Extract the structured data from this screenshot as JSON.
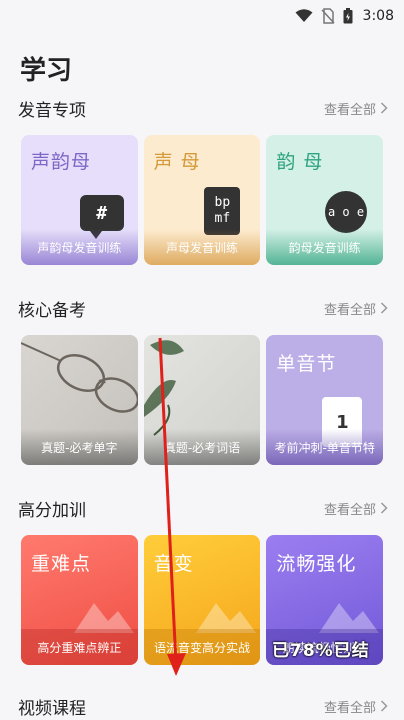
{
  "status": {
    "time": "3:08"
  },
  "page_title": "学习",
  "pronunciation": {
    "title": "发音专项",
    "more": "查看全部",
    "cards": [
      {
        "big": "声韵母",
        "badge": "#",
        "label": "声韵母发音训练"
      },
      {
        "big": "声母",
        "badge": "bp\nmf",
        "label": "声母发音训练"
      },
      {
        "big": "韵母",
        "badge": "a o e",
        "label": "韵母发音训练"
      }
    ]
  },
  "exam": {
    "title": "核心备考",
    "more": "查看全部",
    "cards": [
      {
        "label": "真题-必考单字"
      },
      {
        "label": "真题-必考词语"
      },
      {
        "big": "单音节",
        "flip": "1",
        "label": "考前冲刺-单音节特"
      }
    ]
  },
  "training": {
    "title": "高分加训",
    "more": "查看全部",
    "cards": [
      {
        "big": "重难点",
        "label": "高分重难点辨正"
      },
      {
        "big": "音变",
        "label": "语流音变高分实战"
      },
      {
        "big": "流畅强化",
        "label": "朗读流畅性训练"
      }
    ]
  },
  "video": {
    "title": "视频课程",
    "more": "查看全部"
  },
  "overlay": {
    "text": "已78%已结"
  },
  "colors": {
    "annotation": "#e0201a"
  }
}
